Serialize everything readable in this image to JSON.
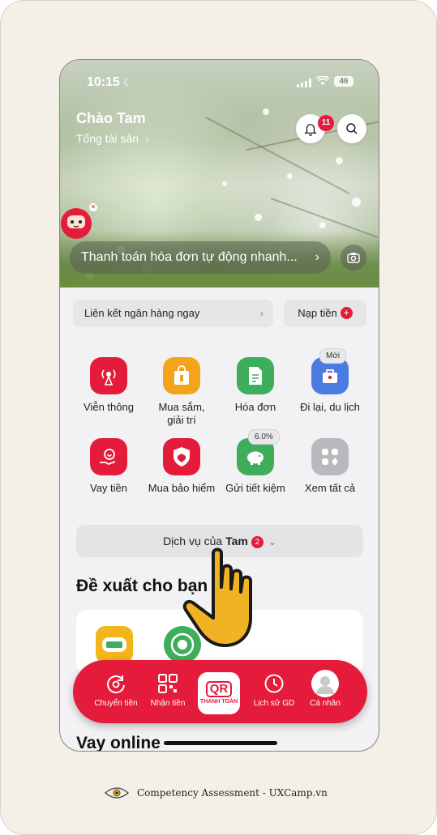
{
  "status_bar": {
    "time": "10:15",
    "battery": "46"
  },
  "header": {
    "greeting": "Chào Tam",
    "assets_link": "Tổng tài sản",
    "notification_count": "11"
  },
  "banner": {
    "text": "Thanh toán hóa đơn tự động nhanh..."
  },
  "quick_actions": {
    "link_bank": "Liên kết ngân hàng ngay",
    "topup": "Nạp tiền"
  },
  "services": [
    {
      "label": "Viễn thông",
      "icon": "broadcast-icon",
      "color": "#e41b3b"
    },
    {
      "label": "Mua sắm,\ngiải trí",
      "icon": "shopping-bag-icon",
      "color": "#f2a51a"
    },
    {
      "label": "Hóa đơn",
      "icon": "document-icon",
      "color": "#3fae5a"
    },
    {
      "label": "Đi lại, du lịch",
      "icon": "travel-icon",
      "color": "#4b7ae0",
      "tag": "Mới"
    },
    {
      "label": "Vay tiền",
      "icon": "loan-icon",
      "color": "#e41b3b"
    },
    {
      "label": "Mua bảo hiểm",
      "icon": "shield-icon",
      "color": "#e41b3b"
    },
    {
      "label": "Gửi tiết kiệm",
      "icon": "piggy-bank-icon",
      "color": "#3fae5a",
      "tag": "6.0%"
    },
    {
      "label": "Xem tất cả",
      "icon": "grid-icon",
      "color": "#b9b8bc"
    }
  ],
  "my_services": {
    "prefix": "Dịch vụ của",
    "name": "Tam",
    "count": "2"
  },
  "suggestions": {
    "title": "Đề xuất cho bạn"
  },
  "bottom_nav": {
    "items": [
      {
        "label": "Chuyển tiền",
        "icon": "transfer-icon"
      },
      {
        "label": "Nhận tiền",
        "icon": "qr-receive-icon"
      },
      {
        "label": "Lịch sử GD",
        "icon": "history-icon"
      },
      {
        "label": "Cá nhân",
        "icon": "avatar-icon"
      }
    ],
    "qr": {
      "big": "QR",
      "small": "THANH TOÁN"
    }
  },
  "loan_section": {
    "title": "Vay online"
  },
  "footer": {
    "text": "Competency Assessment - UXCamp.vn"
  },
  "colors": {
    "brand": "#e41b3b",
    "hand": "#f0b323"
  }
}
